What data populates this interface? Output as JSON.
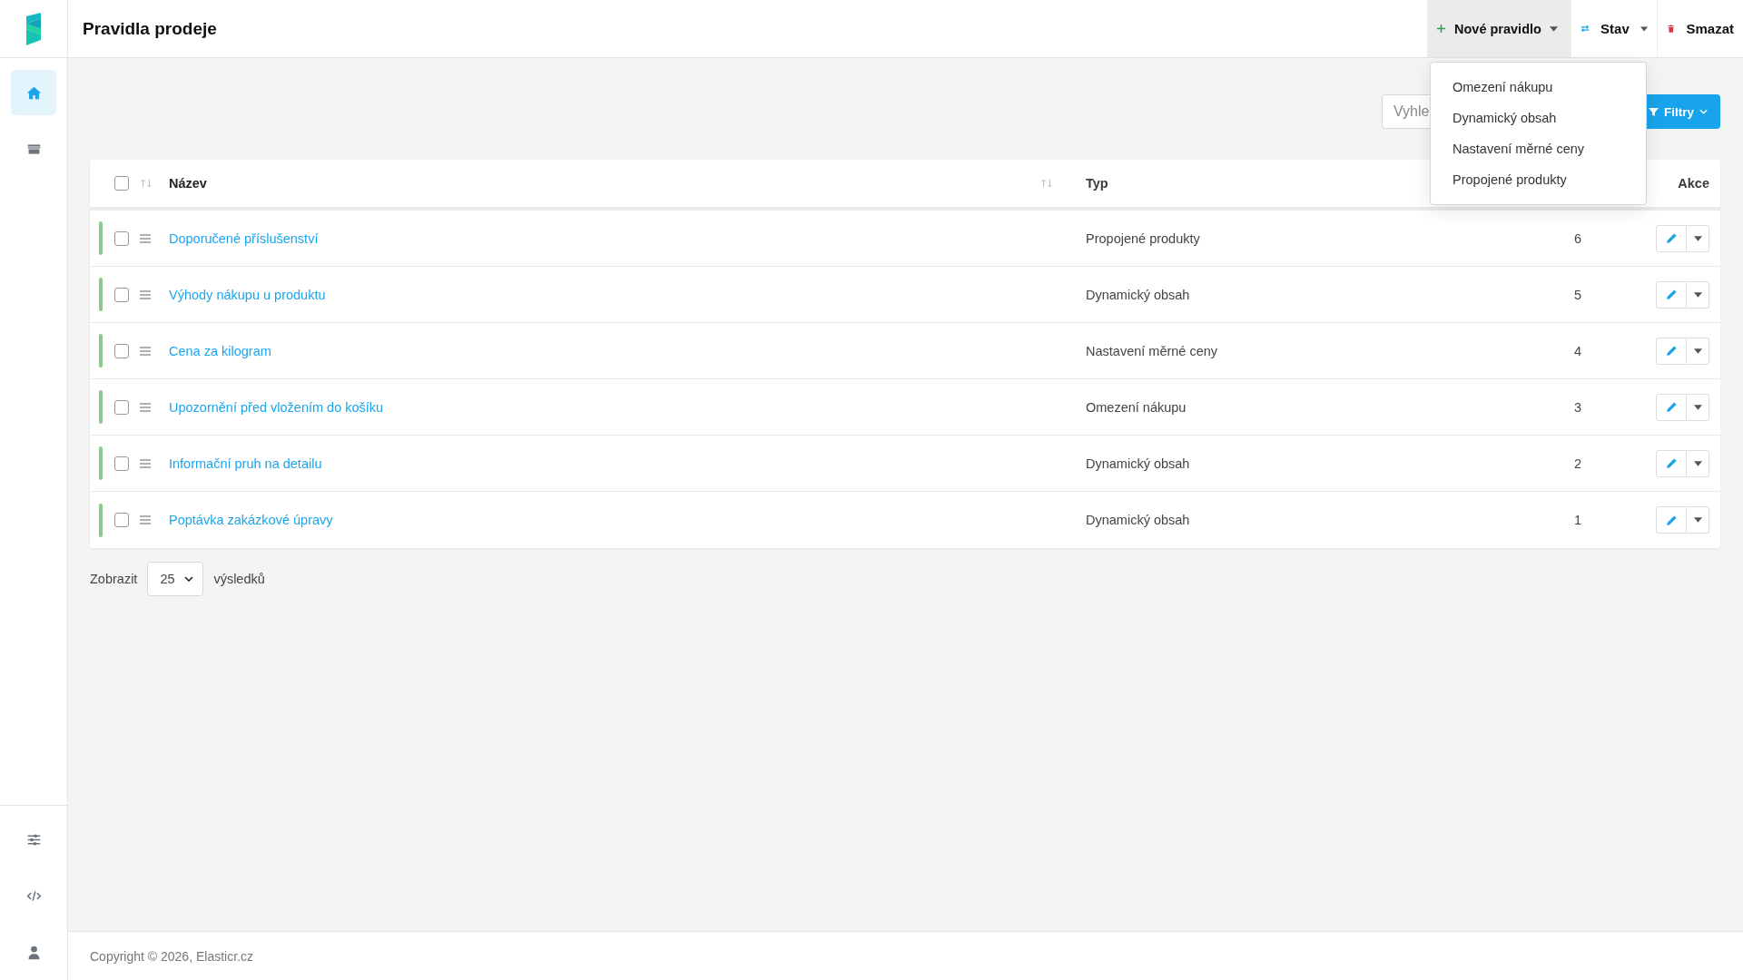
{
  "sidebar": {
    "items": [
      {
        "selected": true
      },
      {
        "selected": false
      }
    ]
  },
  "header": {
    "title": "Pravidla prodeje"
  },
  "toolbar": {
    "buttons": [
      {
        "kind": "new",
        "label": "Nové pravidlo",
        "has_menu": true,
        "open": true,
        "menu": [
          "Omezení nákupu",
          "Dynamický obsah",
          "Nastavení měrné ceny",
          "Propojené produkty"
        ]
      },
      {
        "kind": "status",
        "label": "Stav",
        "has_menu": true,
        "open": false
      },
      {
        "kind": "delete",
        "label": "Smazat",
        "has_menu": false,
        "open": false
      }
    ]
  },
  "search": {
    "placeholder": "Vyhle"
  },
  "filter_button": {
    "label": "Filtry"
  },
  "table": {
    "all_checked": false,
    "columns": [
      {
        "label": "Název",
        "sortable": true
      },
      {
        "label": "Typ",
        "sortable": false
      },
      {
        "label": "Akce",
        "sortable": false
      }
    ],
    "rows": [
      {
        "name": "Doporučené příslušenství",
        "type": "Propojené produkty",
        "column_3": "6",
        "active": true,
        "checked": false
      },
      {
        "name": "Výhody nákupu u produktu",
        "type": "Dynamický obsah",
        "column_3": "5",
        "active": true,
        "checked": false
      },
      {
        "name": "Cena za kilogram",
        "type": "Nastavení měrné ceny",
        "column_3": "4",
        "active": true,
        "checked": false
      },
      {
        "name": "Upozornění před vložením do košíku",
        "type": "Omezení nákupu",
        "column_3": "3",
        "active": true,
        "checked": false
      },
      {
        "name": "Informační pruh na detailu",
        "type": "Dynamický obsah",
        "column_3": "2",
        "active": true,
        "checked": false
      },
      {
        "name": "Poptávka zakázkové úpravy",
        "type": "Dynamický obsah",
        "column_3": "1",
        "active": true,
        "checked": false
      }
    ]
  },
  "pagination": {
    "label": "Zobrazit",
    "page_size": "25",
    "suffix": "výsledků"
  },
  "footer": {
    "text": "Copyright © 2026, Elasticr.cz"
  }
}
